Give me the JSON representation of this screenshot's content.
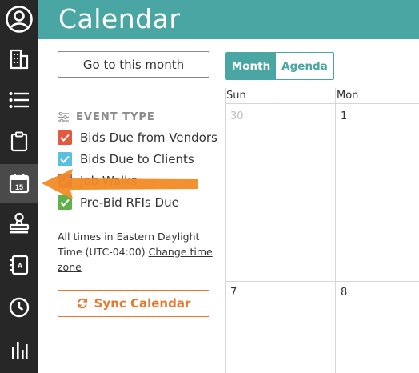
{
  "sidebar": {
    "items": [
      {
        "icon": "user-circle-icon",
        "active": false
      },
      {
        "icon": "building-icon",
        "active": false
      },
      {
        "icon": "list-icon",
        "active": false
      },
      {
        "icon": "clipboard-icon",
        "active": false
      },
      {
        "icon": "calendar-icon",
        "active": true,
        "label": "15"
      },
      {
        "icon": "stamp-icon",
        "active": false
      },
      {
        "icon": "address-book-icon",
        "active": false
      },
      {
        "icon": "clock-icon",
        "active": false
      },
      {
        "icon": "bar-chart-icon",
        "active": false
      }
    ]
  },
  "header": {
    "title": "Calendar",
    "color": "#4aa6a3"
  },
  "controls": {
    "goto_label": "Go to this month",
    "views": [
      "Month",
      "Agenda"
    ],
    "active_view": "Month"
  },
  "event_type": {
    "heading": "EVENT TYPE",
    "items": [
      {
        "label": "Bids Due from Vendors",
        "color": "#e15a3f",
        "checked": true
      },
      {
        "label": "Bids Due to Clients",
        "color": "#5bc0de",
        "checked": true
      },
      {
        "label": "Job Walks",
        "color": "#7b57a8",
        "checked": true
      },
      {
        "label": "Pre-Bid RFIs Due",
        "color": "#5eb04a",
        "checked": true
      }
    ]
  },
  "timezone": {
    "text": "All times in Eastern Daylight Time (UTC-04:00)",
    "link": "Change time zone"
  },
  "sync": {
    "label": "Sync Calendar",
    "color": "#e8792c"
  },
  "calendar": {
    "days_of_week": [
      "Sun",
      "Mon"
    ],
    "week1": [
      "30",
      "1"
    ],
    "week2": [
      "7",
      "8"
    ]
  },
  "annotation": {
    "arrow_color": "#f28a25"
  }
}
